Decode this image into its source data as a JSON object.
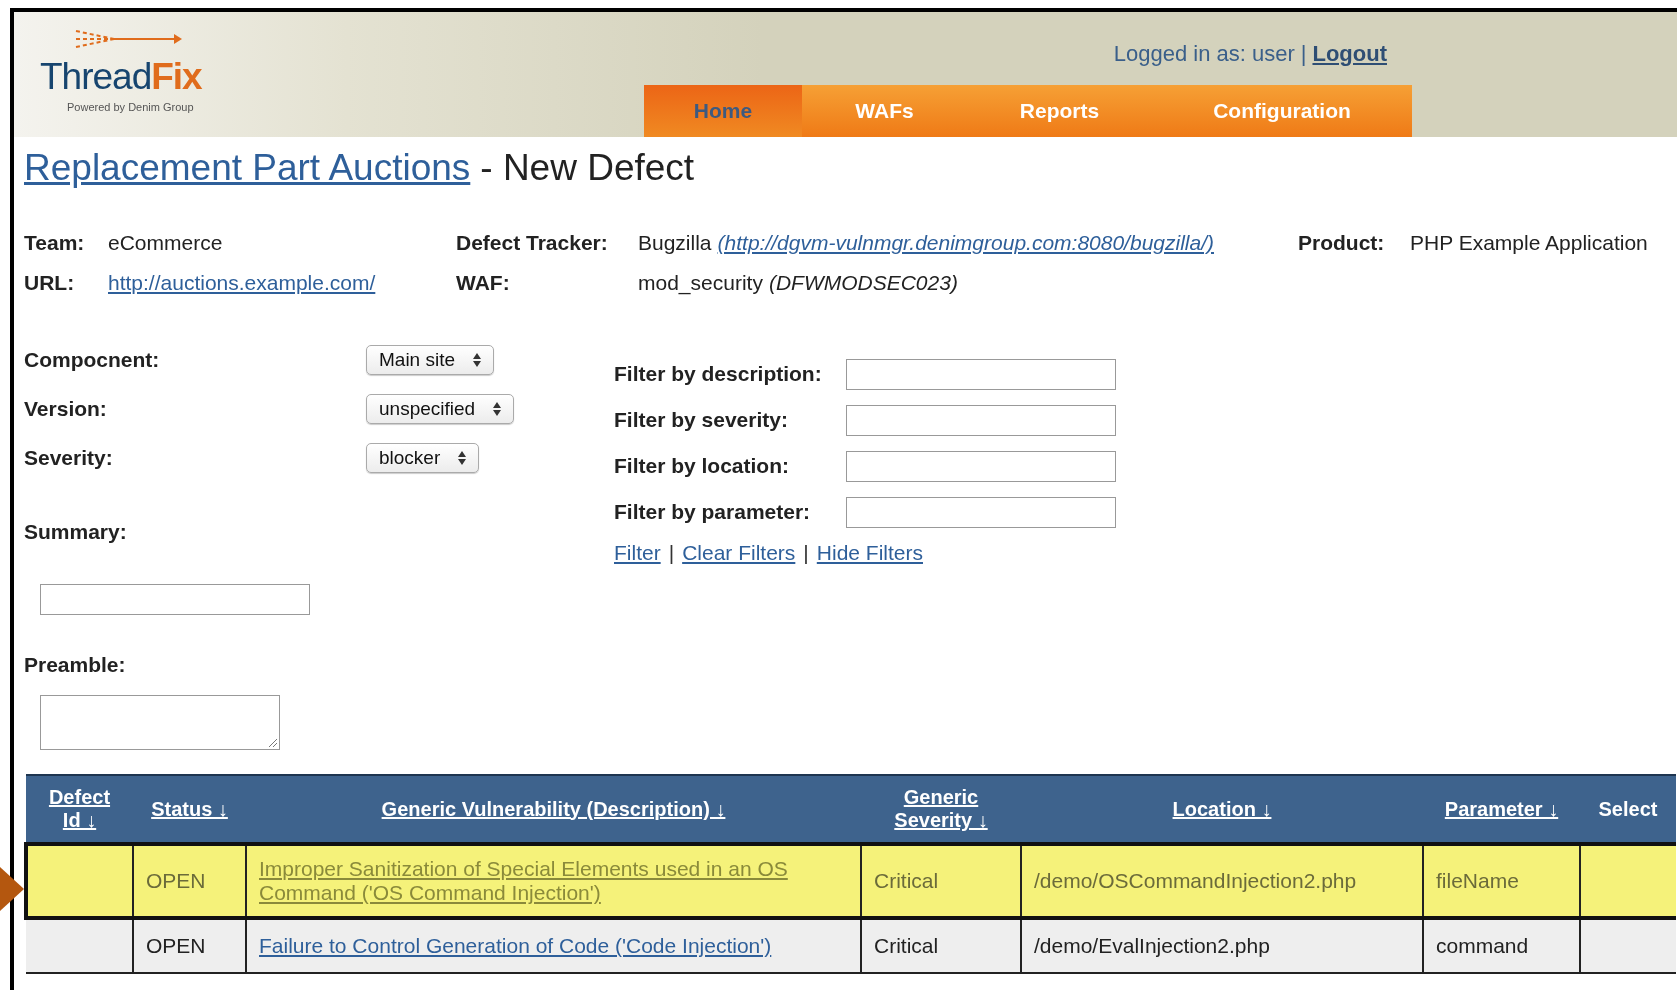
{
  "header": {
    "logo": {
      "part_1": "Thread",
      "part_2": "Fix",
      "tagline": "Powered by Denim Group"
    },
    "user_text": "Logged in as: user",
    "separator": "|",
    "logout": "Logout"
  },
  "tabs": [
    {
      "label": "Home",
      "selected": true
    },
    {
      "label": "WAFs",
      "selected": false
    },
    {
      "label": "Reports",
      "selected": false
    },
    {
      "label": "Configuration",
      "selected": false
    }
  ],
  "title": {
    "link": "Replacement Part Auctions",
    "rest": "- New Defect"
  },
  "info": [
    {
      "label": "Team:",
      "value": "eCommerce"
    },
    {
      "label": "Defect Tracker:",
      "value": "Bugzilla",
      "link": "(http://dgvm-vulnmgr.denimgroup.com:8080/bugzilla/)"
    },
    {
      "label": "Product:",
      "value": "PHP Example Application"
    },
    {
      "label": "URL:",
      "link": "http://auctions.example.com/"
    },
    {
      "label": "WAF:",
      "value": "mod_security",
      "note": "(DFWMODSEC023)"
    }
  ],
  "form": [
    {
      "kind": "select",
      "label": "Compocnent:",
      "value": "Main site"
    },
    {
      "kind": "select",
      "label": "Version:",
      "value": "unspecified"
    },
    {
      "kind": "select",
      "label": "Severity:",
      "value": "blocker"
    },
    {
      "kind": "input",
      "label": "Summary:"
    },
    {
      "kind": "textarea",
      "label": "Preamble:"
    }
  ],
  "filters": {
    "fields": [
      "Filter by description:",
      "Filter by severity:",
      "Filter by location:",
      "Filter by parameter:"
    ],
    "links": [
      "Filter",
      "Clear Filters",
      "Hide Filters"
    ],
    "separators": [
      "|",
      "|"
    ]
  },
  "table": {
    "columns": [
      {
        "label": "Defect Id ↓",
        "link": true
      },
      {
        "label": "Status ↓",
        "link": true
      },
      {
        "label": "Generic Vulnerability (Description) ↓",
        "link": true
      },
      {
        "label": "Generic Severity ↓",
        "link": true
      },
      {
        "label": "Location ↓",
        "link": true
      },
      {
        "label": "Parameter ↓",
        "link": true
      },
      {
        "label": "Select",
        "link": false
      }
    ],
    "rows": [
      {
        "highlighted": true,
        "status": "OPEN",
        "vulnerability": "Improper Sanitization of Special Elements used in an OS Command ('OS Command Injection')",
        "severity": "Critical",
        "location": "/demo/OSCommandInjection2.php",
        "parameter": "fileName"
      },
      {
        "highlighted": false,
        "status": "OPEN",
        "vulnerability": "Failure to Control Generation of Code ('Code Injection')",
        "severity": "Critical",
        "location": "/demo/EvalInjection2.php",
        "parameter": "command"
      }
    ]
  }
}
